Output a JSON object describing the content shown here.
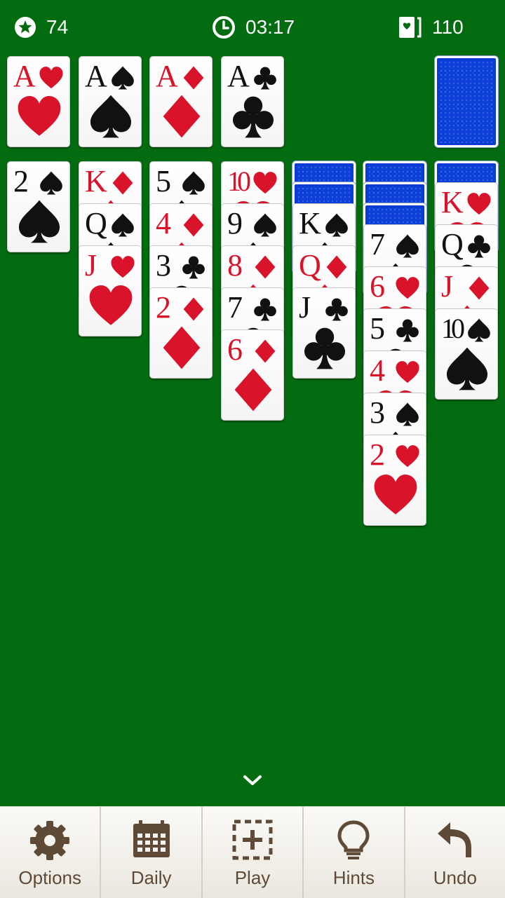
{
  "status": {
    "score": "74",
    "time": "03:17",
    "moves": "110"
  },
  "colors": {
    "felt": "#036b10",
    "red": "#d8132a",
    "black": "#111111",
    "card_back": "#0a3bd4",
    "toolbar_text": "#5e4a36"
  },
  "foundations": [
    {
      "rank": "A",
      "suit": "hearts"
    },
    {
      "rank": "A",
      "suit": "spades"
    },
    {
      "rank": "A",
      "suit": "diamonds"
    },
    {
      "rank": "A",
      "suit": "clubs"
    }
  ],
  "stock": {
    "face_down": true
  },
  "tableau": [
    {
      "face_down": 0,
      "cards": [
        {
          "rank": "2",
          "suit": "spades"
        }
      ]
    },
    {
      "face_down": 0,
      "cards": [
        {
          "rank": "K",
          "suit": "diamonds"
        },
        {
          "rank": "Q",
          "suit": "spades"
        },
        {
          "rank": "J",
          "suit": "hearts"
        }
      ]
    },
    {
      "face_down": 0,
      "cards": [
        {
          "rank": "5",
          "suit": "spades"
        },
        {
          "rank": "4",
          "suit": "diamonds"
        },
        {
          "rank": "3",
          "suit": "clubs"
        },
        {
          "rank": "2",
          "suit": "diamonds"
        }
      ]
    },
    {
      "face_down": 0,
      "cards": [
        {
          "rank": "10",
          "suit": "hearts"
        },
        {
          "rank": "9",
          "suit": "spades"
        },
        {
          "rank": "8",
          "suit": "diamonds"
        },
        {
          "rank": "7",
          "suit": "clubs"
        },
        {
          "rank": "6",
          "suit": "diamonds"
        }
      ]
    },
    {
      "face_down": 2,
      "cards": [
        {
          "rank": "K",
          "suit": "spades"
        },
        {
          "rank": "Q",
          "suit": "diamonds"
        },
        {
          "rank": "J",
          "suit": "clubs"
        }
      ]
    },
    {
      "face_down": 3,
      "cards": [
        {
          "rank": "7",
          "suit": "spades"
        },
        {
          "rank": "6",
          "suit": "hearts"
        },
        {
          "rank": "5",
          "suit": "clubs"
        },
        {
          "rank": "4",
          "suit": "hearts"
        },
        {
          "rank": "3",
          "suit": "spades"
        },
        {
          "rank": "2",
          "suit": "hearts"
        }
      ]
    },
    {
      "face_down": 1,
      "cards": [
        {
          "rank": "K",
          "suit": "hearts"
        },
        {
          "rank": "Q",
          "suit": "clubs"
        },
        {
          "rank": "J",
          "suit": "diamonds"
        },
        {
          "rank": "10",
          "suit": "spades"
        }
      ]
    }
  ],
  "toolbar": {
    "options": "Options",
    "daily": "Daily",
    "play": "Play",
    "hints": "Hints",
    "undo": "Undo"
  }
}
